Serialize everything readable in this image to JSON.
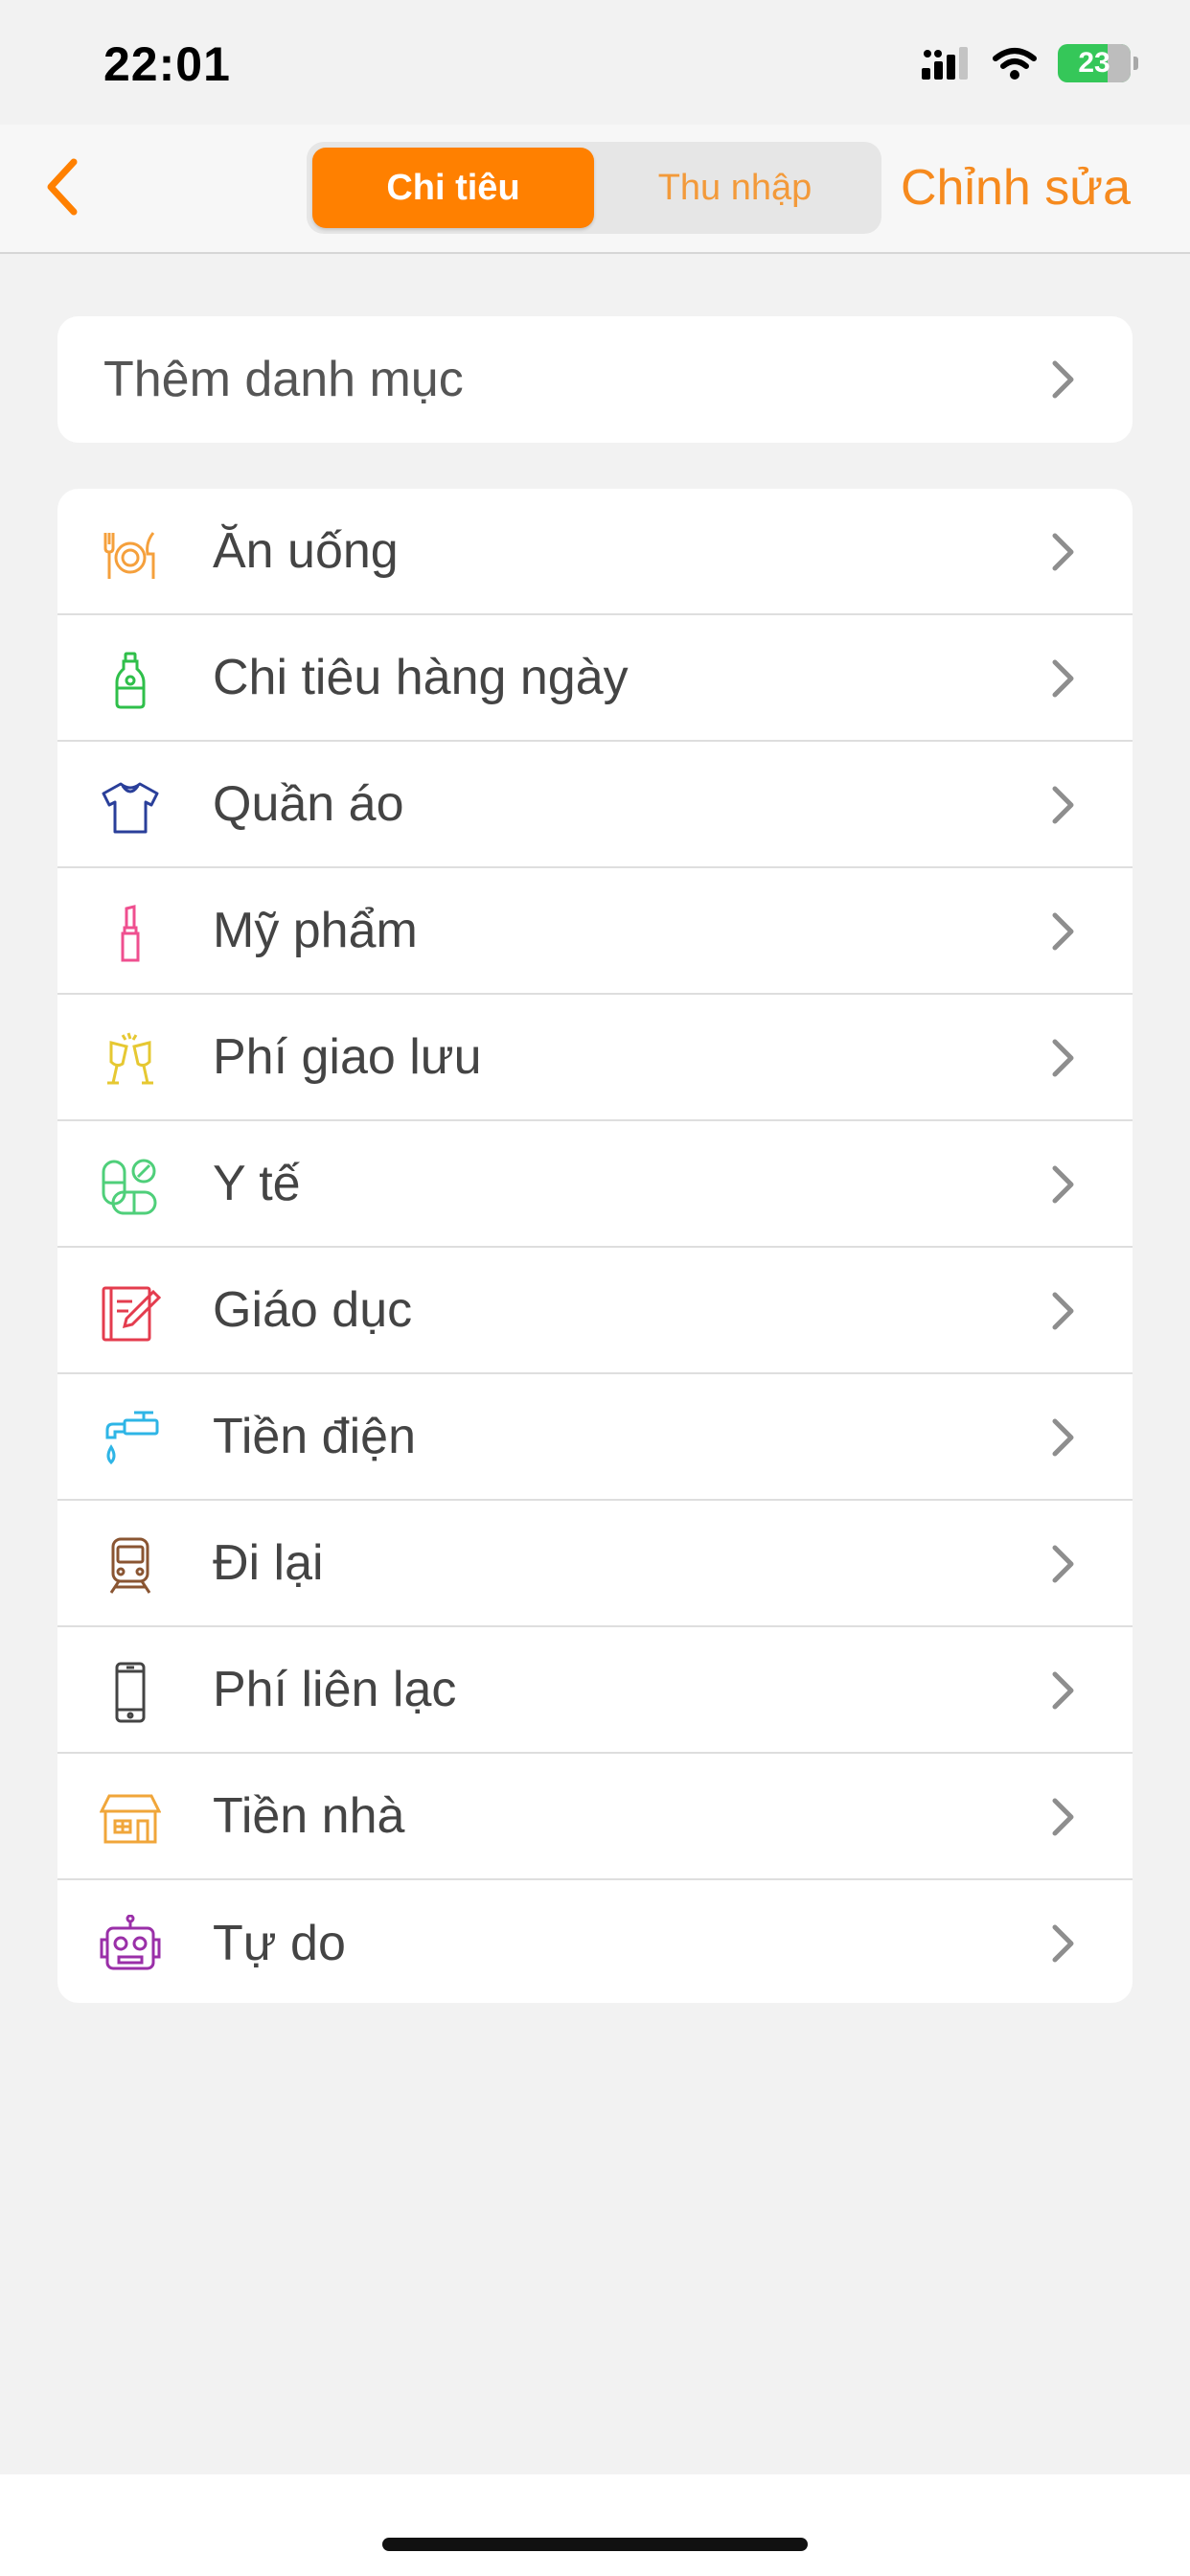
{
  "status_bar": {
    "time": "22:01",
    "battery": "23",
    "icons": [
      "signal-icon",
      "wifi-icon",
      "battery-charging-icon"
    ]
  },
  "nav": {
    "back_icon": "chevron-left-icon",
    "tabs": [
      {
        "label": "Chi tiêu",
        "active": true
      },
      {
        "label": "Thu nhập",
        "active": false
      }
    ],
    "edit_label": "Chỉnh sửa"
  },
  "add_category": {
    "label": "Thêm danh mục"
  },
  "categories": [
    {
      "label": "Ăn uống",
      "icon": "dining-icon",
      "color": "#f5a03c"
    },
    {
      "label": "Chi tiêu hàng ngày",
      "icon": "detergent-bottle-icon",
      "color": "#2fbf4a"
    },
    {
      "label": "Quần áo",
      "icon": "tshirt-icon",
      "color": "#2a3f9a"
    },
    {
      "label": "Mỹ phẩm",
      "icon": "lipstick-icon",
      "color": "#ef4f8f"
    },
    {
      "label": "Phí giao lưu",
      "icon": "cheers-glasses-icon",
      "color": "#e6c832"
    },
    {
      "label": "Y tế",
      "icon": "pills-icon",
      "color": "#4fcf7a"
    },
    {
      "label": "Giáo dục",
      "icon": "notebook-pencil-icon",
      "color": "#e43c4e"
    },
    {
      "label": "Tiền điện",
      "icon": "water-tap-icon",
      "color": "#2eb5e6"
    },
    {
      "label": "Đi lại",
      "icon": "train-icon",
      "color": "#8a5532"
    },
    {
      "label": "Phí liên lạc",
      "icon": "phone-icon",
      "color": "#444444"
    },
    {
      "label": "Tiền nhà",
      "icon": "house-icon",
      "color": "#f0a63a"
    },
    {
      "label": "Tự do",
      "icon": "robot-icon",
      "color": "#9a2fa8"
    }
  ],
  "colors": {
    "accent": "#ff8000",
    "chevron": "#8e8e8e"
  }
}
